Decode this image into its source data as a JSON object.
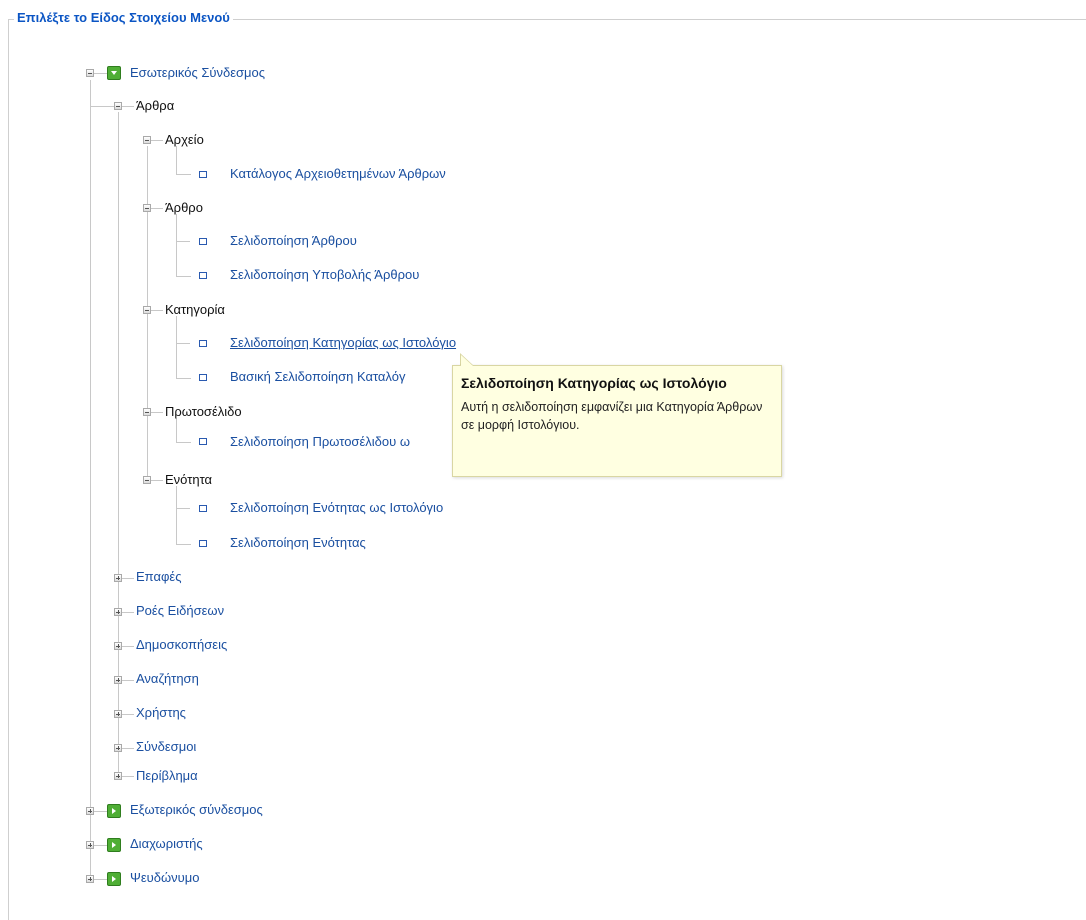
{
  "legend": "Επιλέξτε το Είδος Στοιχείου Μενού",
  "tree": {
    "internal": "Εσωτερικός Σύνδεσμος",
    "articles": "Άρθρα",
    "archive": "Αρχείο",
    "archive_list": "Κατάλογος Αρχειοθετημένων Άρθρων",
    "article": "Άρθρο",
    "article_layout": "Σελιδοποίηση Άρθρου",
    "article_submit": "Σελιδοποίηση Υποβολής Άρθρου",
    "category": "Κατηγορία",
    "category_blog": "Σελιδοποίηση Κατηγορίας ως Ιστολόγιο",
    "category_list": "Βασική Σελιδοποίηση Καταλόγ",
    "frontpage": "Πρωτοσέλιδο",
    "frontpage_blog": "Σελιδοποίηση Πρωτοσέλιδου ω",
    "section": "Ενότητα",
    "section_blog": "Σελιδοποίηση Ενότητας ως Ιστολόγιο",
    "section_layout": "Σελιδοποίηση Ενότητας",
    "contacts": "Επαφές",
    "newsfeeds": "Ροές Ειδήσεων",
    "polls": "Δημοσκοπήσεις",
    "search": "Αναζήτηση",
    "user": "Χρήστης",
    "weblinks": "Σύνδεσμοι",
    "wrapper": "Περίβλημα",
    "external": "Εξωτερικός σύνδεσμος",
    "separator": "Διαχωριστής",
    "alias": "Ψευδώνυμο"
  },
  "tooltip": {
    "title": "Σελιδοποίηση Κατηγορίας ως Ιστολόγιο",
    "body": "Αυτή η σελιδοποίηση εμφανίζει μια Κατηγορία Άρθρων σε μορφή Ιστολόγιου."
  },
  "colors": {
    "link": "#1a4fa0",
    "legend": "#0b55c4",
    "icon_green": "#4fae35",
    "tooltip_bg": "#ffffe1"
  },
  "icons": {
    "expanded": "minus-box-icon",
    "collapsed": "plus-box-icon",
    "menu_type": "green-arrow-icon",
    "leaf": "square-bullet-icon"
  }
}
